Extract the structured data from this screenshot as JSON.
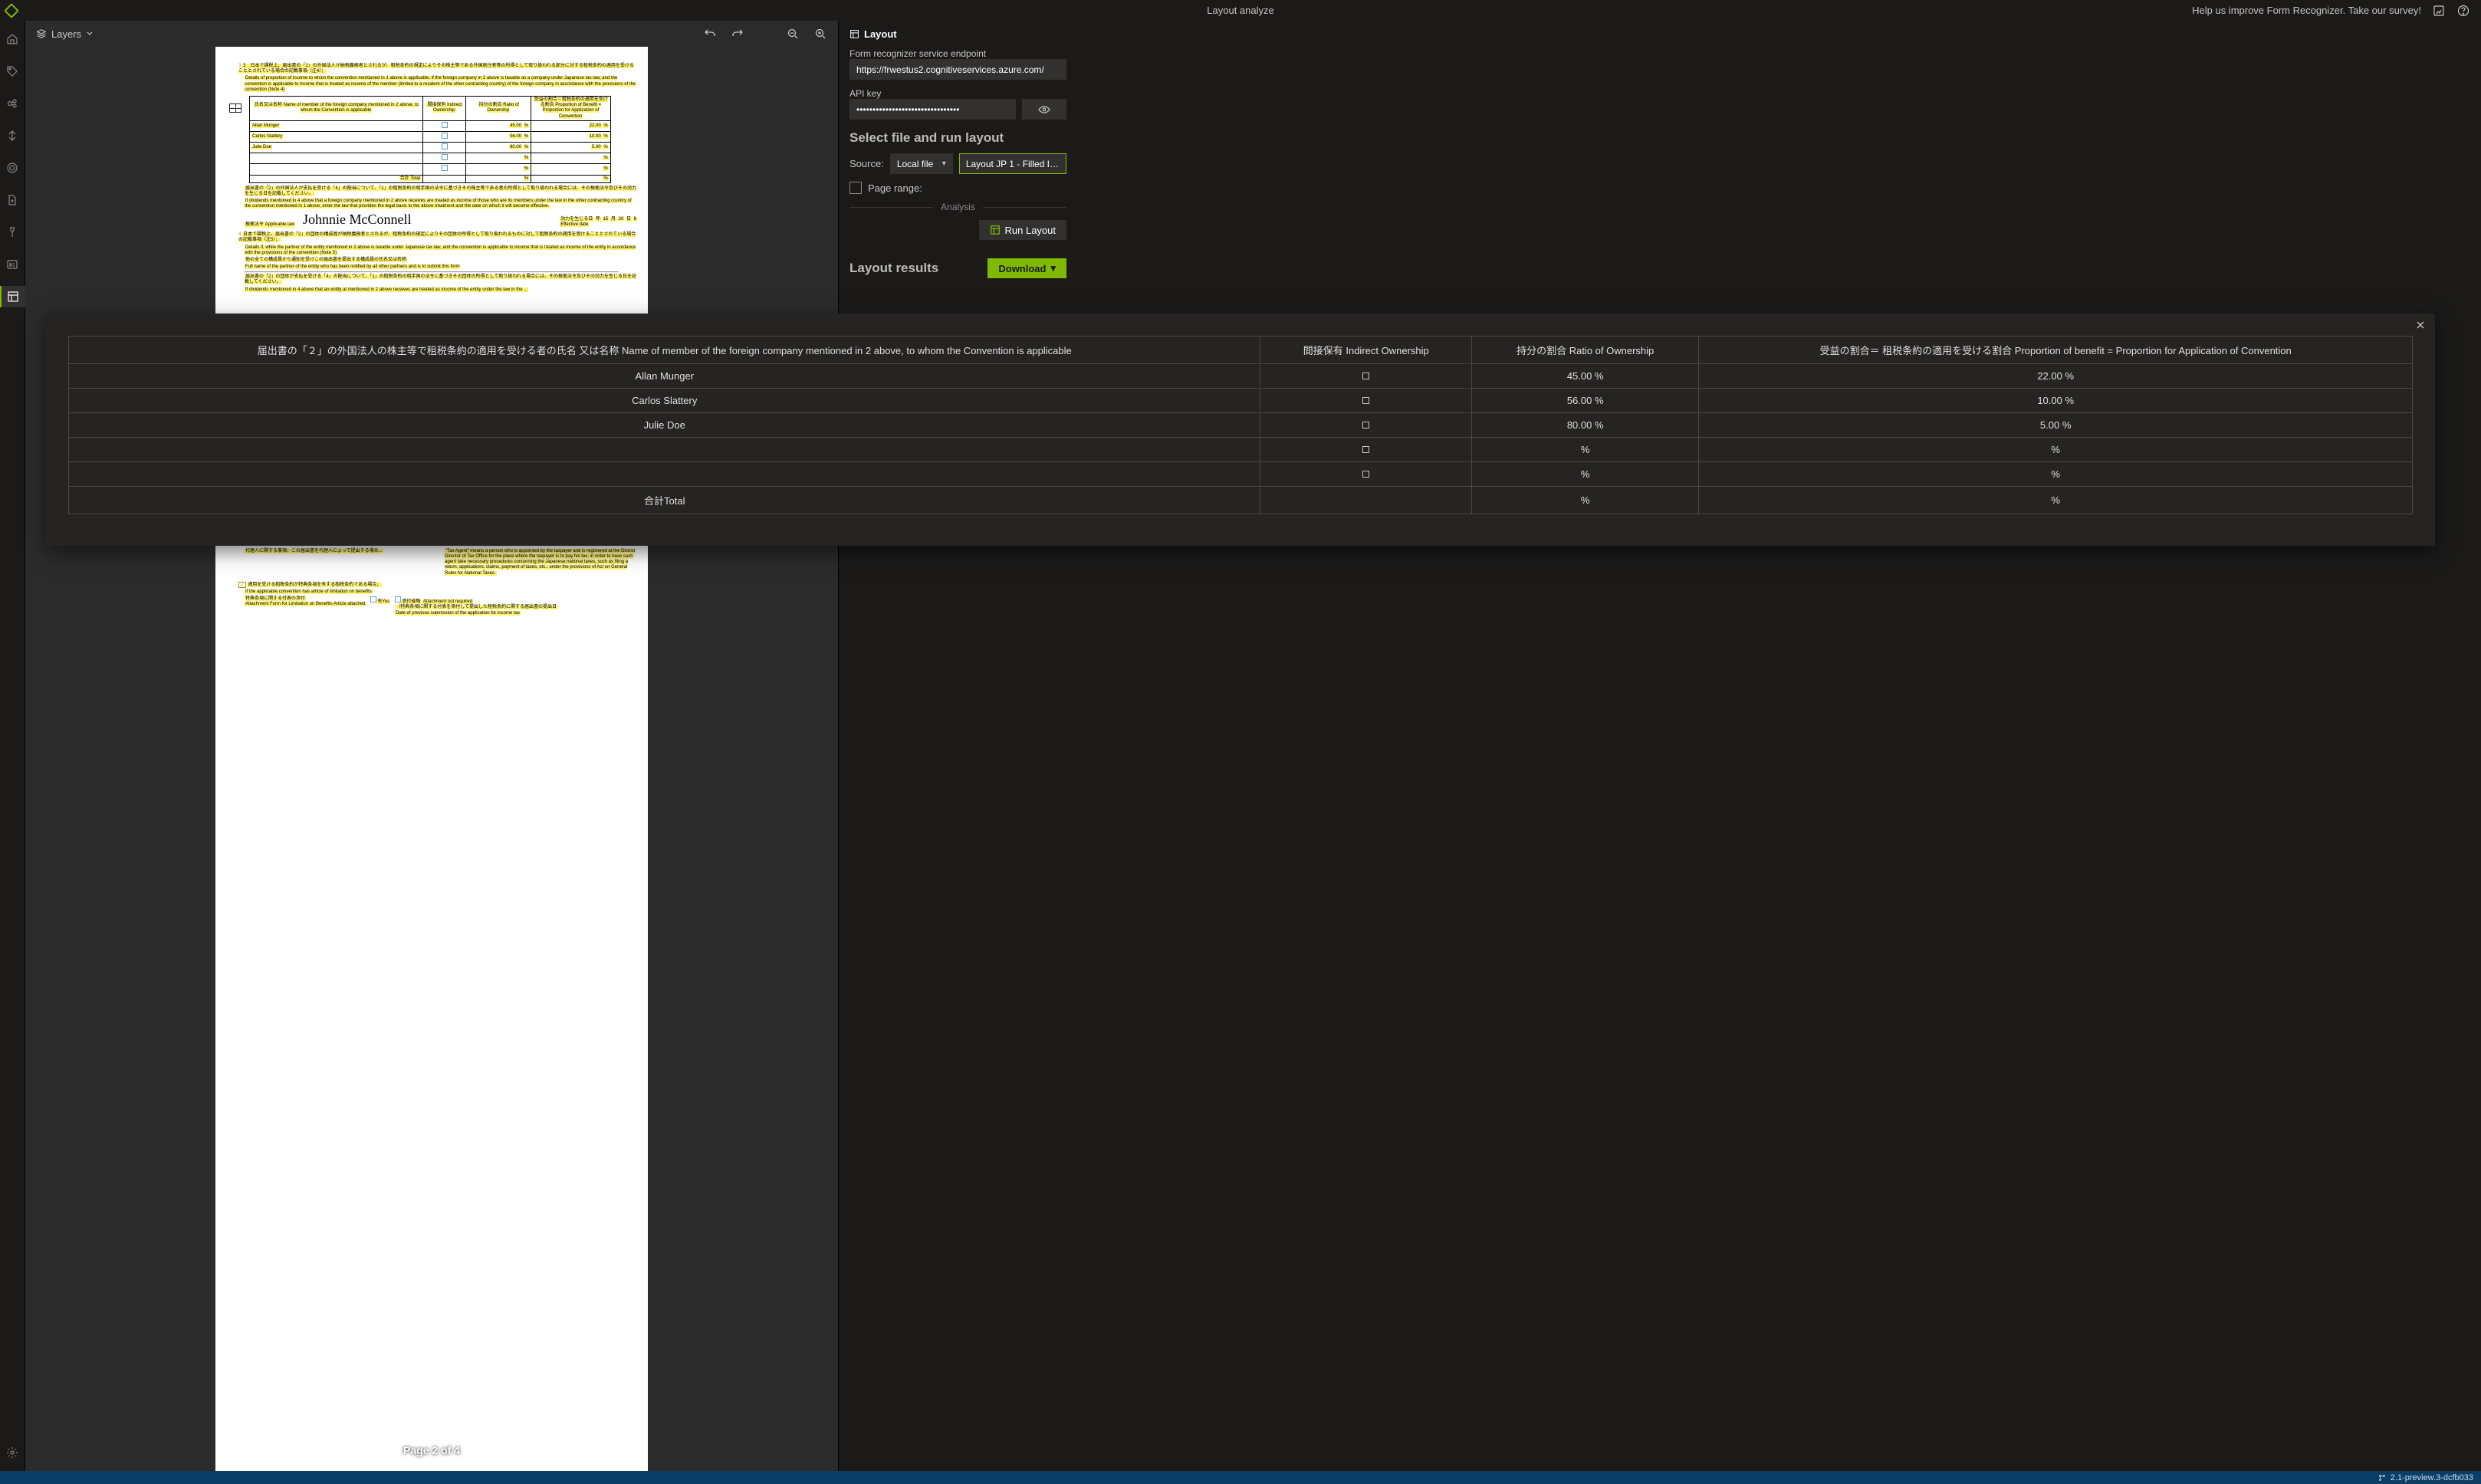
{
  "topbar": {
    "title": "Layout analyze",
    "survey": "Help us improve Form Recognizer. Take our survey!"
  },
  "canvas": {
    "layers_label": "Layers"
  },
  "doc": {
    "page_label": "Page 2 of 4",
    "para1_jp": "3　日本で課税上、届出書の「2」の外国法人が納税義務者とされるが、租税条約の規定によりその株主等である外国居住者等の所得として取り扱われる部分に対する租税条約の適用を受けることとされている場合の記載事項（注4）；",
    "para1_en": "Details of proportion of income to which the convention mentioned in 1 above is applicable, if the foreign company in 2 above is taxable as a company under Japanese tax law, and the convention is applicable to income that is treated as income of the member (limited to a resident of the other contracting country) of the foreign company in accordance with the provisions of the convention (Note 4)",
    "th_name": "氏名又は名称 Name of member of the foreign company mentioned in 2 above, to whom the Convention is applicable",
    "th_indirect": "間接保有 Indirect Ownership",
    "th_ratio": "持分の割合 Ratio of Ownership",
    "th_benefit": "受益の割合＝租税条約の適用を受ける割合 Proportion of Benefit = Proportion for Application of Convention",
    "tiny_rows": [
      [
        "Allan Munger",
        "",
        "45.00",
        "22.00"
      ],
      [
        "Carlos Slattery",
        "",
        "56.00",
        "10.00"
      ],
      [
        "Julie Doe",
        "",
        "80.00",
        "5.00"
      ],
      [
        "",
        "",
        "",
        ""
      ],
      [
        "",
        "",
        "",
        ""
      ]
    ],
    "tiny_total_jp": "合計 Total",
    "para2a": "届出書の「2」の外国法人が支払を受ける「4」の配当について、「1」の租税条約の相手国の法令に基づきその株主等である者の所得として取り扱われる場合には、その根拠法令及びその効力を生じる日を記載してください。",
    "para2b": "If dividends mentioned in 4 above that a foreign company mentioned in 2 above receives are treated as income of those who are its members under the law in the other contracting country of the convention mentioned in 1 above, enter the law that provides the legal basis to the above treatment and the date on which it will become effective.",
    "applicable_law_label": "根拠法令 Applicable law",
    "signature": "Johnnie McConnell",
    "effective_label_jp": "効力を生じる日",
    "effective_label_en": "Effective date",
    "eff_y": "年",
    "eff_m": "月",
    "eff_d": "日",
    "eff_yv": "15",
    "eff_mv": "20",
    "eff_dv": "8",
    "para3a": "日本で課税上、届出書の「2」の団体の構成員が納税義務者とされるが、租税条約の規定によりその団体の所得として取り扱われるものに対して租税条約の適用を受けることとされている場合の記載事項（注5）；",
    "para3b": "Details if, while the partner of the entity mentioned in 2 above is taxable under Japanese tax law, and the convention is applicable to income that is treated as income of the entity in accordance with the provisions of the convention (Note 5)",
    "para3c": "他の全ての構成員から通知を受けこの届出書を提出する構成員の氏名又は名称",
    "para3d": "Full name of the partner of the entity who has been notified by all other partners and is to submit this form",
    "para4a": "届出書の「2」の団体が支払を受ける「4」の配当について、「1」の租税条約の相手国の法令に基づきその団体の所得として取り扱われる場合には、その根拠法令及びその効力を生じる日を記載してください。",
    "para4b": "If dividends mentioned in 4 above that an entity at mentioned in 2 above receives are treated as income of the entity under the law in the ...",
    "para_tax_agent": "\"Tax Agent\" means a person who is appointed by the taxpayer and is registered at the District Director of Tax Office for the place where the taxpayer is to pay his tax, in order to have such agent take necessary procedures concerning the Japanese national taxes, such as filing a return, applications, claims, payment of taxes, etc., under the provisions of Act on General Rules for National Taxes.",
    "limit_jp": "適用を受ける租税条約が特典条項を有する租税条約である場合；",
    "limit_en": "If the applicable convention has article of limitation on benefits",
    "attach_jp1": "特典条項に関する付表の添付",
    "attach_en1": "Attachment Form for Limitation on Benefits Article attached",
    "attach_yes": "有Yes",
    "attach_jp2_a": "添付省略",
    "attach_jp2_b": "Attachment not required",
    "attach_jp3_a": "（特典条項に関する付表を添付して提出した租税条約に関する届出書の提出日",
    "attach_jp3_b": "Date of previous submission of the application for income tax"
  },
  "props": {
    "heading": "Layout",
    "endpoint_label": "Form recognizer service endpoint",
    "endpoint_value": "https://frwestus2.cognitiveservices.azure.com/",
    "apikey_label": "API key",
    "apikey_value": "••••••••••••••••••••••••••••••••",
    "select_title": "Select file and run layout",
    "source_label": "Source:",
    "source_value": "Local file",
    "file_value": "Layout JP 1 - Filled In.pdf",
    "pagerange_label": "Page range:",
    "analysis_label": "Analysis",
    "run_label": "Run Layout",
    "results_title": "Layout results",
    "download_label": "Download"
  },
  "modal": {
    "headers": {
      "name": "届出書の「２」の外国法人の株主等で租税条約の適用を受ける者の氏名 又は名称 Name of member of the foreign company mentioned in 2 above, to whom the Convention is applicable",
      "indirect": "間接保有 Indirect Ownership",
      "ratio": "持分の割合 Ratio of Ownership",
      "benefit": "受益の割合＝ 租税条約の適用を受ける割合 Proportion of benefit = Proportion for Application of Convention"
    },
    "rows": [
      {
        "name": "Allan Munger",
        "indirect": "□",
        "ratio": "45.00 %",
        "benefit": "22.00 %"
      },
      {
        "name": "Carlos Slattery",
        "indirect": "□",
        "ratio": "56.00 %",
        "benefit": "10.00 %"
      },
      {
        "name": "Julie Doe",
        "indirect": "□",
        "ratio": "80.00 %",
        "benefit": "5.00 %"
      },
      {
        "name": "",
        "indirect": "□",
        "ratio": "%",
        "benefit": "%"
      },
      {
        "name": "",
        "indirect": "□",
        "ratio": "%",
        "benefit": "%"
      },
      {
        "name": "合計Total",
        "indirect": "",
        "ratio": "%",
        "benefit": "%"
      }
    ]
  },
  "status": {
    "version": "2.1-preview.3-dcfb033"
  }
}
